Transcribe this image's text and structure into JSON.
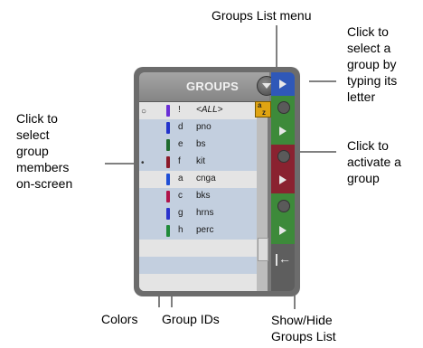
{
  "callouts": {
    "groups_list_menu": "Groups List menu",
    "select_by_letter": [
      "Click to",
      "select a",
      "group by",
      "typing its",
      "letter"
    ],
    "activate_group": [
      "Click to",
      "activate a",
      "group"
    ],
    "select_members": [
      "Click to",
      "select",
      "group",
      "members",
      "on-screen"
    ],
    "colors": "Colors",
    "group_ids": "Group IDs",
    "show_hide": [
      "Show/Hide",
      "Groups List"
    ]
  },
  "panel": {
    "title": "GROUPS",
    "sort_badge": [
      "a",
      "z"
    ],
    "hide_glyph": "|←",
    "rows": [
      {
        "id": "!",
        "name": "<ALL>",
        "color": "#6a2fd6",
        "selector": "○"
      },
      {
        "id": "d",
        "name": "pno",
        "color": "#2233cc",
        "selector": ""
      },
      {
        "id": "e",
        "name": "bs",
        "color": "#1f6b2e",
        "selector": ""
      },
      {
        "id": "f",
        "name": "kit",
        "color": "#8b1a2a",
        "selector": "•"
      },
      {
        "id": "a",
        "name": "cnga",
        "color": "#1f4fd6",
        "selector": ""
      },
      {
        "id": "c",
        "name": "bks",
        "color": "#b0144a",
        "selector": ""
      },
      {
        "id": "g",
        "name": "hrns",
        "color": "#2a33cc",
        "selector": ""
      },
      {
        "id": "h",
        "name": "perc",
        "color": "#1f8a3a",
        "selector": ""
      }
    ]
  },
  "colors": {
    "row_selected": "#c3cfdf",
    "row_plain": "#e4e4e4",
    "strip_blue": "#2f58b8",
    "strip_green": "#3d8a3a",
    "strip_red": "#8a2230",
    "strip_gray": "#5e5e5e",
    "badge_gold": "#e0a412"
  }
}
